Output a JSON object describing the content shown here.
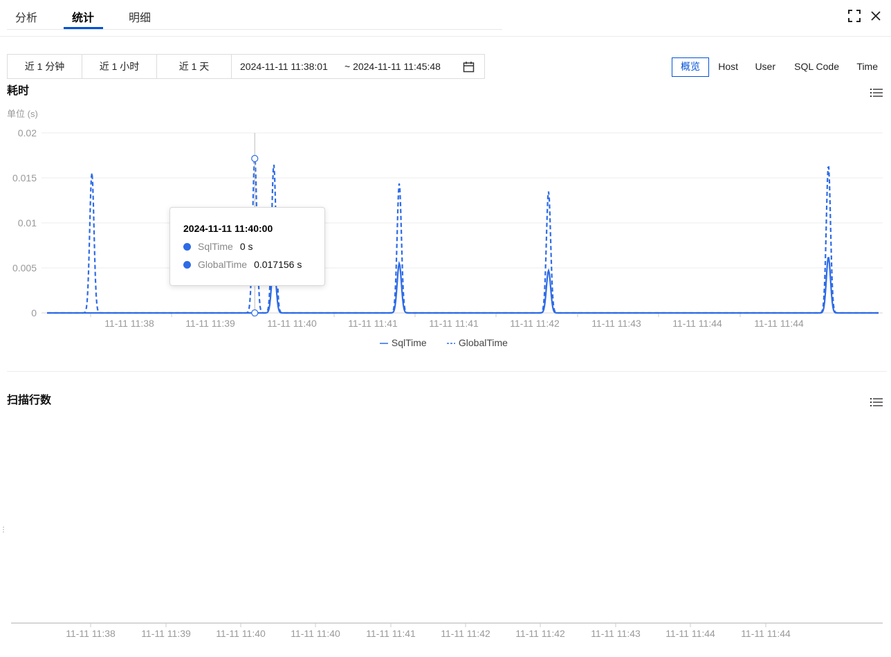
{
  "tabs": [
    {
      "label": "分析",
      "active": false
    },
    {
      "label": "统计",
      "active": true
    },
    {
      "label": "明细",
      "active": false
    }
  ],
  "window_icons": [
    "fullscreen-icon",
    "close-icon"
  ],
  "toolbar": {
    "quick_ranges": [
      "近 1 分钟",
      "近 1 小时",
      "近 1 天"
    ],
    "date_start": "2024-11-11 11:38:01",
    "date_end": "~ 2024-11-11 11:45:48",
    "calendar_icon": "calendar-icon"
  },
  "dimension_tabs": [
    {
      "label": "概览",
      "active": true
    },
    {
      "label": "Host",
      "active": false
    },
    {
      "label": "User",
      "active": false
    },
    {
      "label": "SQL Code",
      "active": false
    },
    {
      "label": "Time",
      "active": false
    }
  ],
  "accent_color": "#0052d9",
  "series_color": "#2e6be6",
  "time_section": {
    "title": "耗时",
    "unit_label": "单位 (s)",
    "menu_icon": "list-icon"
  },
  "tooltip": {
    "title": "2024-11-11 11:40:00",
    "rows": [
      {
        "name": "SqlTime",
        "value": "0 s"
      },
      {
        "name": "GlobalTime",
        "value": "0.017156 s"
      }
    ]
  },
  "scan_section": {
    "title": "扫描行数",
    "menu_icon": "list-icon",
    "side_mark": "⋮"
  },
  "chart_data": [
    {
      "type": "line",
      "title": "耗时",
      "ylabel": "单位 (s)",
      "ylim": [
        0,
        0.02
      ],
      "yticks": [
        "0.02",
        "0.015",
        "0.01",
        "0.005",
        "0"
      ],
      "xticks": [
        "11-11 11:38",
        "11-11 11:39",
        "11-11 11:40",
        "11-11 11:41",
        "11-11 11:41",
        "11-11 11:42",
        "11-11 11:43",
        "11-11 11:44",
        "11-11 11:44"
      ],
      "grid": true,
      "legend": "bottom",
      "x_domain": [
        0,
        1
      ],
      "series": [
        {
          "name": "SqlTime",
          "style": "solid",
          "peaks": [
            {
              "x": 0.2727,
              "y": 0.0058
            },
            {
              "x": 0.4236,
              "y": 0.0055
            },
            {
              "x": 0.6031,
              "y": 0.0047
            },
            {
              "x": 0.9397,
              "y": 0.0062
            }
          ]
        },
        {
          "name": "GlobalTime",
          "style": "dashed",
          "peaks": [
            {
              "x": 0.0539,
              "y": 0.0156
            },
            {
              "x": 0.2498,
              "y": 0.0172
            },
            {
              "x": 0.2727,
              "y": 0.0165
            },
            {
              "x": 0.4236,
              "y": 0.0144
            },
            {
              "x": 0.6031,
              "y": 0.0135
            },
            {
              "x": 0.9397,
              "y": 0.0164
            }
          ]
        }
      ],
      "hover": {
        "x": 0.2498,
        "values": [
          0,
          0.017156
        ]
      }
    },
    {
      "type": "line",
      "title": "扫描行数",
      "xticks": [
        "11-11 11:38",
        "11-11 11:39",
        "11-11 11:40",
        "11-11 11:40",
        "11-11 11:41",
        "11-11 11:42",
        "11-11 11:42",
        "11-11 11:43",
        "11-11 11:44",
        "11-11 11:44"
      ],
      "series": []
    }
  ]
}
